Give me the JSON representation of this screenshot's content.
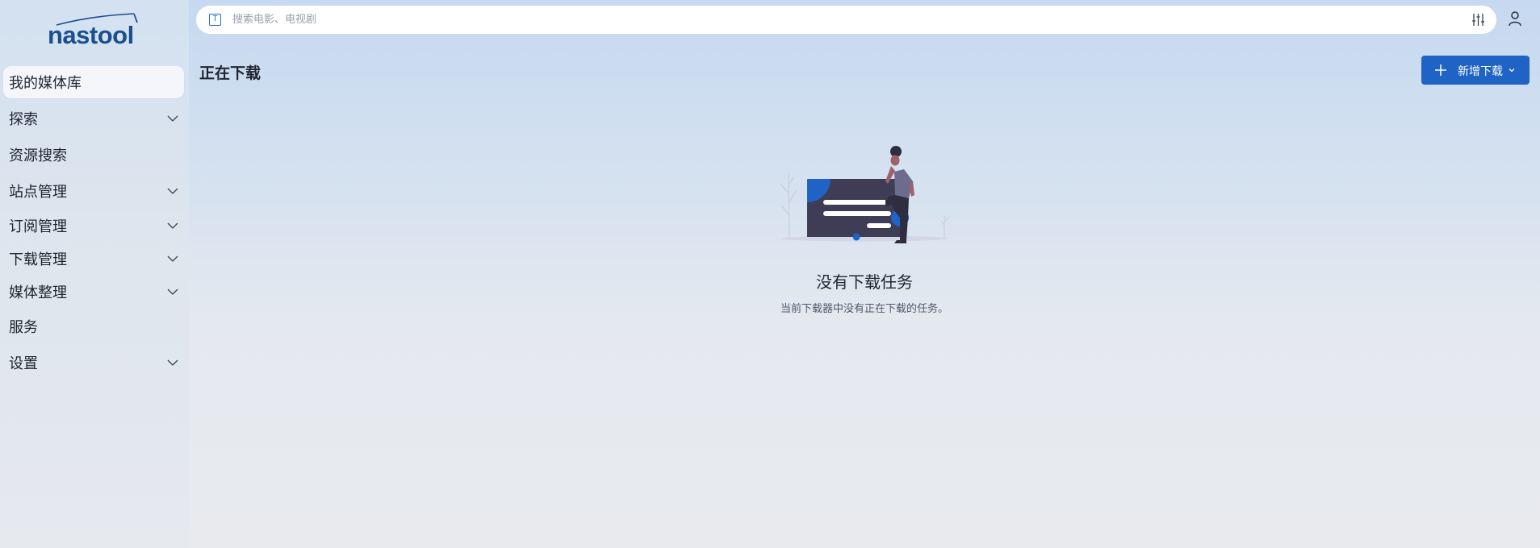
{
  "app": {
    "logo_text": "nastool"
  },
  "search": {
    "placeholder": "搜索电影、电视剧",
    "type_badge": "T"
  },
  "sidebar": {
    "items": [
      {
        "label": "我的媒体库",
        "active": true,
        "expandable": false
      },
      {
        "label": "探索",
        "active": false,
        "expandable": true
      },
      {
        "label": "资源搜索",
        "active": false,
        "expandable": false
      },
      {
        "label": "站点管理",
        "active": false,
        "expandable": true
      },
      {
        "label": "订阅管理",
        "active": false,
        "expandable": true
      },
      {
        "label": "下载管理",
        "active": false,
        "expandable": true
      },
      {
        "label": "媒体整理",
        "active": false,
        "expandable": true
      },
      {
        "label": "服务",
        "active": false,
        "expandable": false
      },
      {
        "label": "设置",
        "active": false,
        "expandable": true
      }
    ]
  },
  "header": {
    "title": "正在下载",
    "new_download_label": "新增下载"
  },
  "empty_state": {
    "title": "没有下载任务",
    "subtitle": "当前下载器中没有正在下载的任务。"
  },
  "colors": {
    "accent": "#1f63c4",
    "logo": "#1b4f8e"
  },
  "icons": {
    "search_type": "t-icon",
    "filter": "sliders-icon",
    "user": "user-icon",
    "expand": "chevron-down-icon",
    "add": "plus-icon"
  }
}
